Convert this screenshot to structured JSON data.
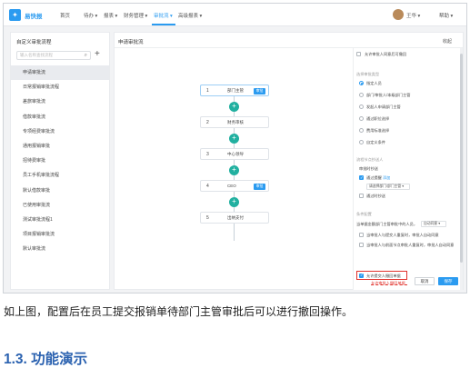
{
  "nav": {
    "brand": "易快报",
    "items": [
      "首页",
      "待办",
      "报表",
      "财务管理",
      "审批流",
      "高级报表"
    ],
    "active": "审批流",
    "user": "王华",
    "help": "帮助"
  },
  "left_panel": {
    "title": "自定义审批流程",
    "search_placeholder": "输入名称查找流程",
    "add_label": "+",
    "flows": [
      "申请审批流",
      "日常报销审批流程",
      "差旅审批流",
      "借款审批流",
      "专项经费审批流",
      "通用报销审批",
      "招待费审批",
      "员工手机审批流程",
      "默认借款审批",
      "已使用审批流",
      "测试审批流程1",
      "项目报销审批流",
      "默认审批流"
    ],
    "active_index": 0
  },
  "main": {
    "title": "申请审批流",
    "collapse": "收起",
    "nodes": [
      {
        "no": "1",
        "label": "部门主管",
        "badge": "审批"
      },
      {
        "no": "2",
        "label": "财务审核",
        "badge": ""
      },
      {
        "no": "3",
        "label": "中心领导",
        "badge": ""
      },
      {
        "no": "4",
        "label": "CEO",
        "badge": "审批"
      },
      {
        "no": "5",
        "label": "出纳支付",
        "badge": ""
      }
    ]
  },
  "settings": {
    "top_note": "允许审批人同意后可撤回",
    "approver_type_heading": "选择审批类型",
    "approver_types": [
      "指定人员",
      "部门/审批人/本级部门主管",
      "发起人申请部门主管",
      "通过职位选择",
      "费用标准选择",
      "自定义条件"
    ],
    "approver_selected": 0,
    "cc_heading": "流程节点抄送人",
    "cc_label": "审批时抄送",
    "cc_check_label": "通过提醒",
    "cc_link": "添加",
    "cc_select": "请选择部门/部门主管",
    "cc_note": "通过时抄送",
    "cond_heading": "条件配置",
    "cond_text": "当单据金额部门主管审批中的人员，",
    "cond_select": "自动同意",
    "options": [
      "当审批人与提交人重复时，审批人自动同意",
      "当审批人与前面节点审批人重复时，审批人自动同意"
    ],
    "allow_withdraw": "允许提交人撤回单据",
    "withdraw_note": "允许审批人撤回单据",
    "cancel": "取消",
    "save": "保存"
  },
  "doc": {
    "caption": "如上图，配置后在员工提交报销单待部门主管审批后可以进行撤回操作。",
    "heading": "1.3. 功能演示"
  }
}
